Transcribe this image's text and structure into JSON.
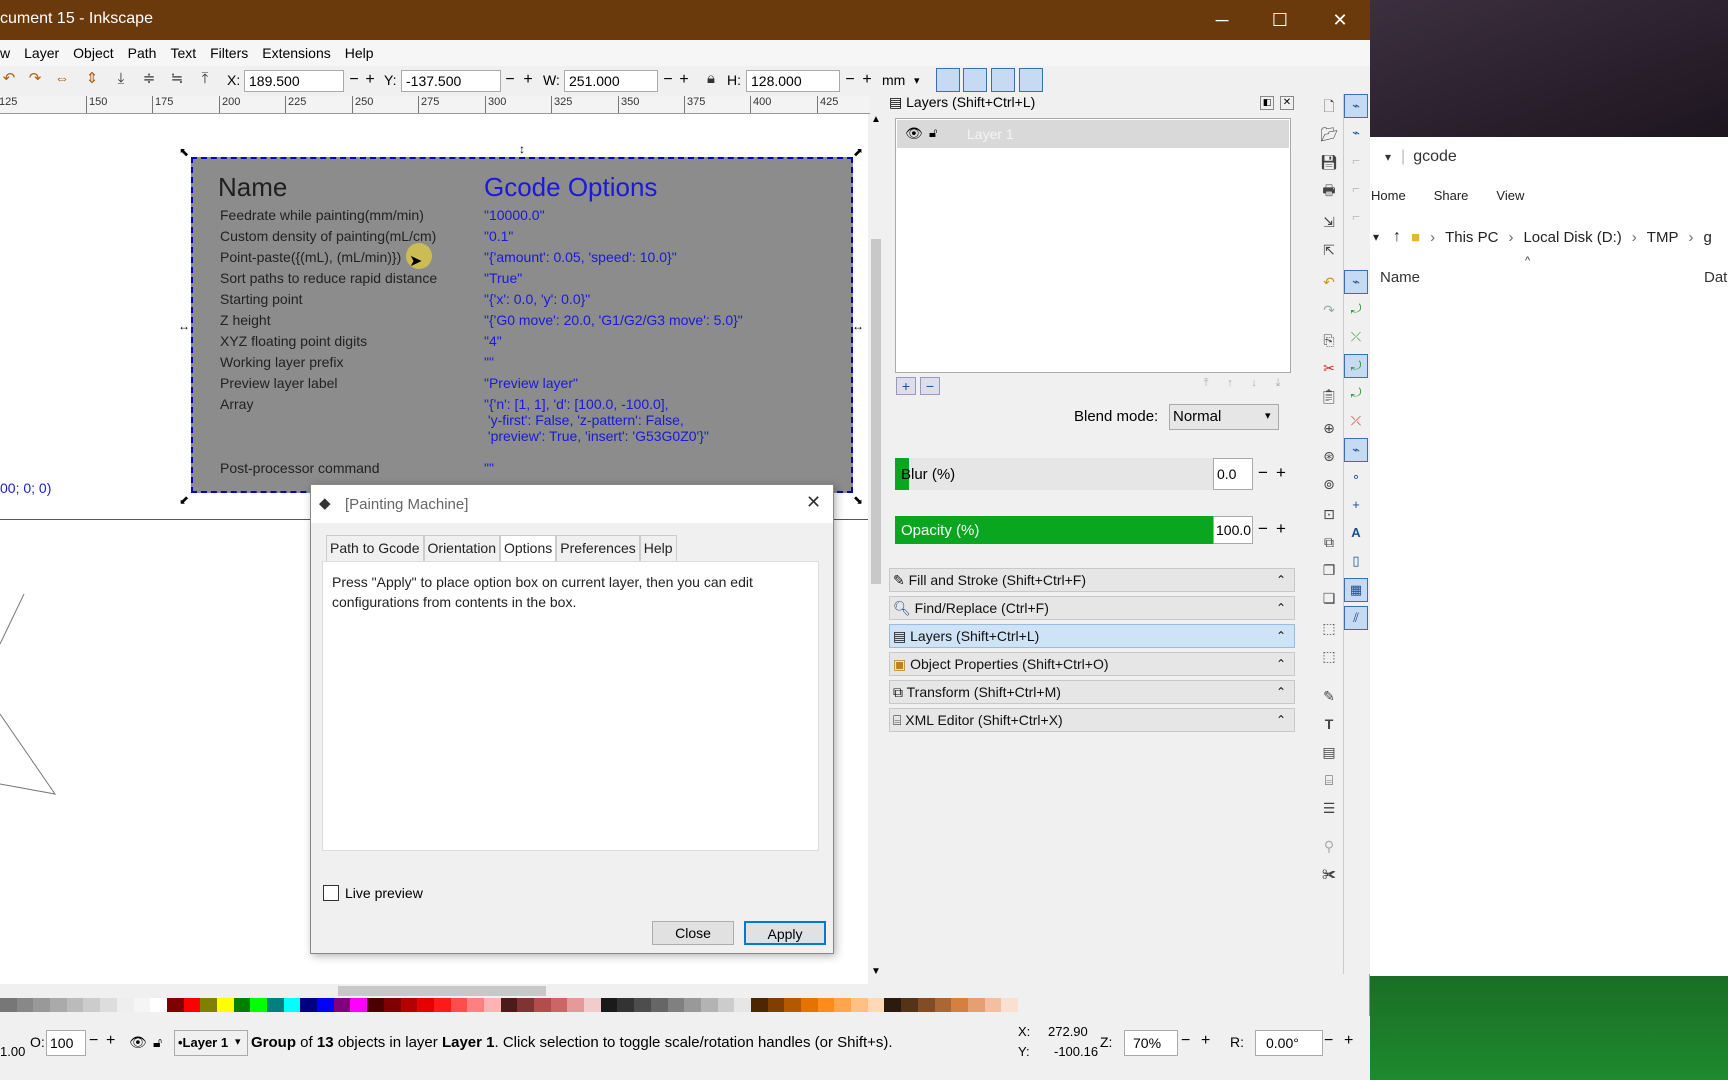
{
  "window": {
    "title": "cument 15 - Inkscape",
    "minimize": "─",
    "maximize": "☐",
    "close": "✕"
  },
  "menu": [
    "w",
    "Layer",
    "Object",
    "Path",
    "Text",
    "Filters",
    "Extensions",
    "Help"
  ],
  "toolbar": {
    "x_label": "X:",
    "x_value": "189.500",
    "y_label": "Y:",
    "y_value": "-137.500",
    "w_label": "W:",
    "w_value": "251.000",
    "h_label": "H:",
    "h_value": "128.000",
    "unit": "mm"
  },
  "ruler": [
    "125",
    "150",
    "175",
    "200",
    "225",
    "250",
    "275",
    "300",
    "325",
    "350",
    "375",
    "400",
    "425"
  ],
  "canvas": {
    "coord_text": "00; 0; 0)",
    "group": {
      "name_header": "Name",
      "options_header": "Gcode Options",
      "rows": [
        {
          "key": "Feedrate while painting(mm/min)",
          "value": "\"10000.0\""
        },
        {
          "key": "Custom density of painting(mL/cm)",
          "value": "\"0.1\""
        },
        {
          "key": "Point-paste({(mL), (mL/min)})",
          "value": "\"{'amount': 0.05, 'speed': 10.0}\""
        },
        {
          "key": "Sort paths to reduce rapid distance",
          "value": "\"True\""
        },
        {
          "key": "Starting point",
          "value": "\"{'x': 0.0, 'y': 0.0}\""
        },
        {
          "key": "Z height",
          "value": "\"{'G0 move': 20.0, 'G1/G2/G3 move': 5.0}\""
        },
        {
          "key": "XYZ floating point digits",
          "value": "\"4\""
        },
        {
          "key": "Working layer prefix",
          "value": "\"\""
        },
        {
          "key": "Preview layer label",
          "value": "\"Preview layer\""
        },
        {
          "key": "Array",
          "value": "\"{'n': [1, 1], 'd': [100.0, -100.0],\n 'y-first': False, 'z-pattern': False,\n 'preview': True, 'insert': 'G53G0Z0'}\""
        },
        {
          "key": "Post-processor command",
          "value": "\"\""
        }
      ]
    }
  },
  "dialog": {
    "title": "[Painting Machine]",
    "tabs": [
      "Path to Gcode",
      "Orientation",
      "Options",
      "Preferences",
      "Help"
    ],
    "active_tab": "Options",
    "body_text": "Press \"Apply\" to place option box on current layer, then you can edit configurations from contents in the box.",
    "live_preview_label": "Live preview",
    "close_label": "Close",
    "apply_label": "Apply"
  },
  "layers_panel": {
    "title": "Layers (Shift+Ctrl+L)",
    "layer_name": "Layer 1",
    "blend_label": "Blend mode:",
    "blend_value": "Normal",
    "blur_label": "Blur (%)",
    "blur_value": "0.0",
    "opacity_label": "Opacity (%)",
    "opacity_value": "100.0",
    "opacity_fill": 1.0
  },
  "docked": [
    {
      "label": "Fill and Stroke (Shift+Ctrl+F)",
      "icon": "brush-icon"
    },
    {
      "label": "Find/Replace (Ctrl+F)",
      "icon": "magnifier-icon"
    },
    {
      "label": "Layers (Shift+Ctrl+L)",
      "icon": "layers-icon"
    },
    {
      "label": "Object Properties (Shift+Ctrl+O)",
      "icon": "properties-icon"
    },
    {
      "label": "Transform (Shift+Ctrl+M)",
      "icon": "transform-icon"
    },
    {
      "label": "XML Editor (Shift+Ctrl+X)",
      "icon": "xml-icon"
    }
  ],
  "explorer": {
    "address": "gcode",
    "ribbon": [
      "Home",
      "Share",
      "View"
    ],
    "crumbs": [
      "This PC",
      "Local Disk (D:)",
      "TMP",
      "g"
    ],
    "col_name": "Name",
    "col_date": "Dat"
  },
  "status": {
    "opacity_label": "O:",
    "opacity_value": "100",
    "layer": "•Layer 1",
    "message_pre": "Group",
    "message_of": " of ",
    "message_count": "13",
    "message_mid": " objects in layer ",
    "message_layer": "Layer 1",
    "message_post": ". Click selection to toggle scale/rotation handles (or Shift+s).",
    "x_label": "X:",
    "x": "272.90",
    "y_label": "Y:",
    "y": "-100.16",
    "z_label": "Z:",
    "zoom": "70%",
    "r_label": "R:",
    "rotation": "0.00°",
    "left_value": "1.00"
  },
  "colors": {
    "titlebar": "#6b3a0c",
    "accent_blue": "#1a1ad8",
    "opacity_green": "#0aa620"
  }
}
